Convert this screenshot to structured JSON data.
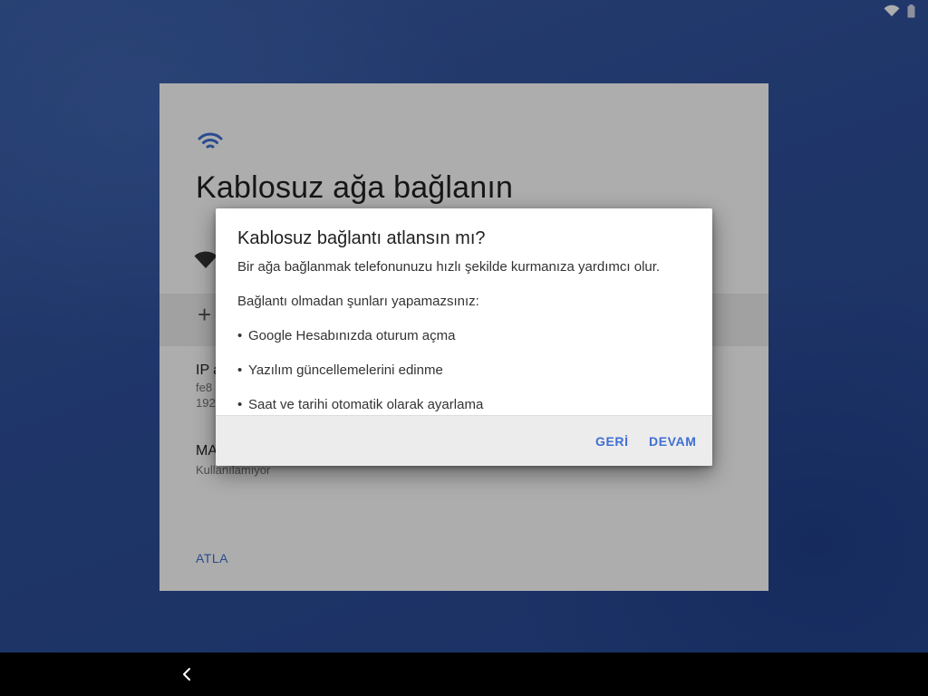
{
  "colors": {
    "accent": "#3f6fd1",
    "wallpaper": "#2f4f99",
    "nav_bar": "#000000"
  },
  "setup": {
    "title": "Kablosuz ağa bağlanın",
    "wifi_icon": "wifi-icon",
    "ip_label": "IP a",
    "ip_value_line1": "fe8",
    "ip_value_line2": "192",
    "mac_label": "MA",
    "mac_value": "Kullanılamıyor",
    "skip_label": "ATLA"
  },
  "dialog": {
    "title": "Kablosuz bağlantı atlansın mı?",
    "intro": "Bir ağa bağlanmak telefonunuzu hızlı şekilde kurmanıza yardımcı olur.",
    "subheading": "Bağlantı olmadan şunları yapamazsınız:",
    "bullets": [
      "Google Hesabınızda oturum açma",
      "Yazılım güncellemelerini edinme",
      "Saat ve tarihi otomatik olarak ayarlama"
    ],
    "back_label": "GERİ",
    "continue_label": "DEVAM"
  },
  "status_bar": {
    "icons": [
      "wifi-no-internet-icon",
      "battery-icon"
    ]
  },
  "nav_bar": {
    "icons": [
      "back-chevron-icon"
    ]
  }
}
